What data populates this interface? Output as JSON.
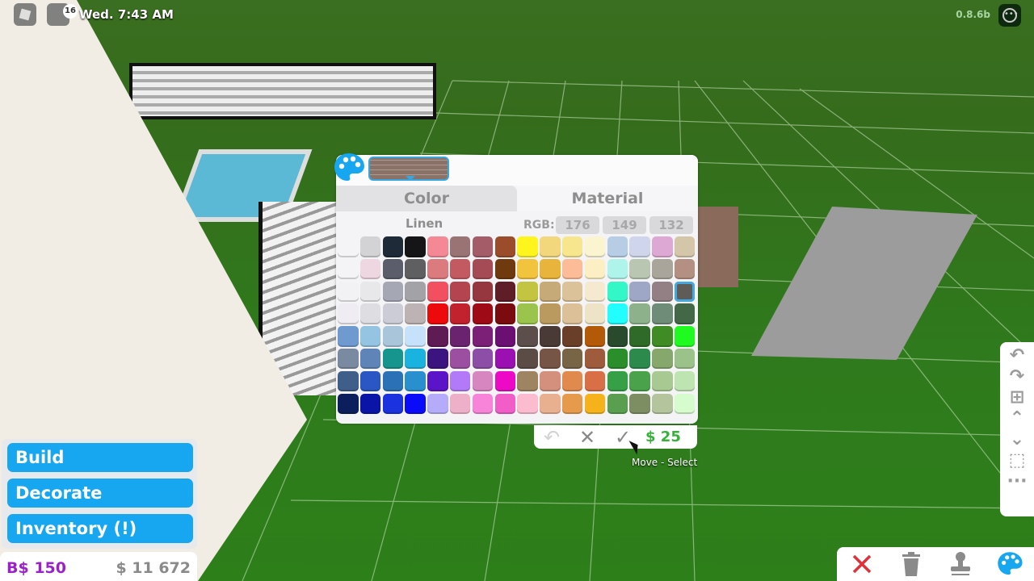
{
  "topbar": {
    "notification_count": "16",
    "time": "Wed. 7:43 AM",
    "version": "0.8.6b",
    "more_icon": "ellipsis-icon"
  },
  "palette_window": {
    "preview_icon": "palette-icon",
    "preview_material": "brick",
    "tabs": [
      {
        "label": "Color",
        "active": true
      },
      {
        "label": "Material",
        "active": false
      }
    ],
    "selected_color_name": "Linen",
    "rgb_label": "RGB:",
    "rgb": [
      "176",
      "149",
      "132"
    ],
    "selected_swatch_index": 47,
    "swatches": [
      "#f4f3f6",
      "#d3d2d5",
      "#1f2a38",
      "#151517",
      "#f48894",
      "#9a7375",
      "#a35c68",
      "#9b4d2b",
      "#fdf51c",
      "#f3d77c",
      "#f7e68c",
      "#fbf5cf",
      "#b7cde6",
      "#cfd6ec",
      "#dea8d4",
      "#d4c7a9",
      "#f4f3f6",
      "#eed7e0",
      "#5b5d6a",
      "#5f5f61",
      "#dc7b7d",
      "#c35a62",
      "#a54b55",
      "#6e3a0e",
      "#f2c43e",
      "#e9b43c",
      "#fbbc97",
      "#fdefc4",
      "#aff4ea",
      "#b9c6b1",
      "#aaa59b",
      "#b39082",
      "#f2f1f3",
      "#e8e7ea",
      "#a6a7b5",
      "#a3a3a7",
      "#f24f60",
      "#b44550",
      "#96373f",
      "#5f1d27",
      "#c3c542",
      "#c6aa77",
      "#dbc298",
      "#f5ead0",
      "#34f7c8",
      "#9ea7c6",
      "#928085",
      "#5f5c58",
      "#efedf3",
      "#dddde2",
      "#cbccd6",
      "#bdb3b4",
      "#ec0a0c",
      "#c2222e",
      "#9e0a16",
      "#7a0c0f",
      "#9bc44d",
      "#bb9a60",
      "#dcc098",
      "#ede4c8",
      "#22fdfd",
      "#8db28b",
      "#6f8c78",
      "#436848",
      "#6f9ad0",
      "#94c4e2",
      "#a8c5da",
      "#c6e2fb",
      "#5f1c54",
      "#6a236f",
      "#7b2076",
      "#6b0f72",
      "#5c4e4b",
      "#4a3a35",
      "#6a3f2a",
      "#b35a09",
      "#2a4a2e",
      "#2f6a28",
      "#3e8c23",
      "#1ffb20",
      "#7a8aa1",
      "#5f85b8",
      "#16958f",
      "#1ab3e0",
      "#3c1480",
      "#9c4fa0",
      "#8c4ea6",
      "#9a10b0",
      "#5b4c45",
      "#775546",
      "#786545",
      "#9e5c3c",
      "#2a8e2a",
      "#2b8a4c",
      "#86a86c",
      "#9bc289",
      "#3f5e8a",
      "#2a57c4",
      "#2a71b6",
      "#2a8fcf",
      "#5b14c8",
      "#b27af8",
      "#d886c0",
      "#ec0ac6",
      "#9e8460",
      "#d4907c",
      "#e08a4e",
      "#d96f46",
      "#35a045",
      "#4aa34a",
      "#a8c991",
      "#bde4b1",
      "#0c1f5c",
      "#0a15a8",
      "#1a33de",
      "#0a0cf9",
      "#b4acfa",
      "#eeb0c8",
      "#f884da",
      "#f15ec8",
      "#fbbcd0",
      "#e9b090",
      "#e59a4c",
      "#f5b21a",
      "#5a9e50",
      "#7c8e62",
      "#b4c59e",
      "#d6fccd"
    ]
  },
  "confirm_bar": {
    "undo_icon": "undo-icon",
    "cancel_icon": "close-icon",
    "confirm_icon": "checkmark-icon",
    "price": "$ 25",
    "tooltip": "Move - Select"
  },
  "left_menu": {
    "buttons": [
      "Build",
      "Decorate",
      "Inventory (!)"
    ],
    "bloxbux": "B$ 150",
    "money": "$ 11 672"
  },
  "right_toolbar": {
    "items": [
      "undo-icon",
      "redo-icon",
      "grid-icon",
      "chevron-up-icon",
      "chevron-down-icon",
      "select-area-icon",
      "more-icon"
    ]
  },
  "bottom_toolbar": {
    "items": [
      "close-icon",
      "trash-icon",
      "stamp-icon",
      "palette-icon"
    ]
  },
  "colors": {
    "accent_blue": "#17a6f0",
    "price_green": "#36b23a",
    "bloxbux_purple": "#9a22c8",
    "delete_red": "#e0303a"
  }
}
